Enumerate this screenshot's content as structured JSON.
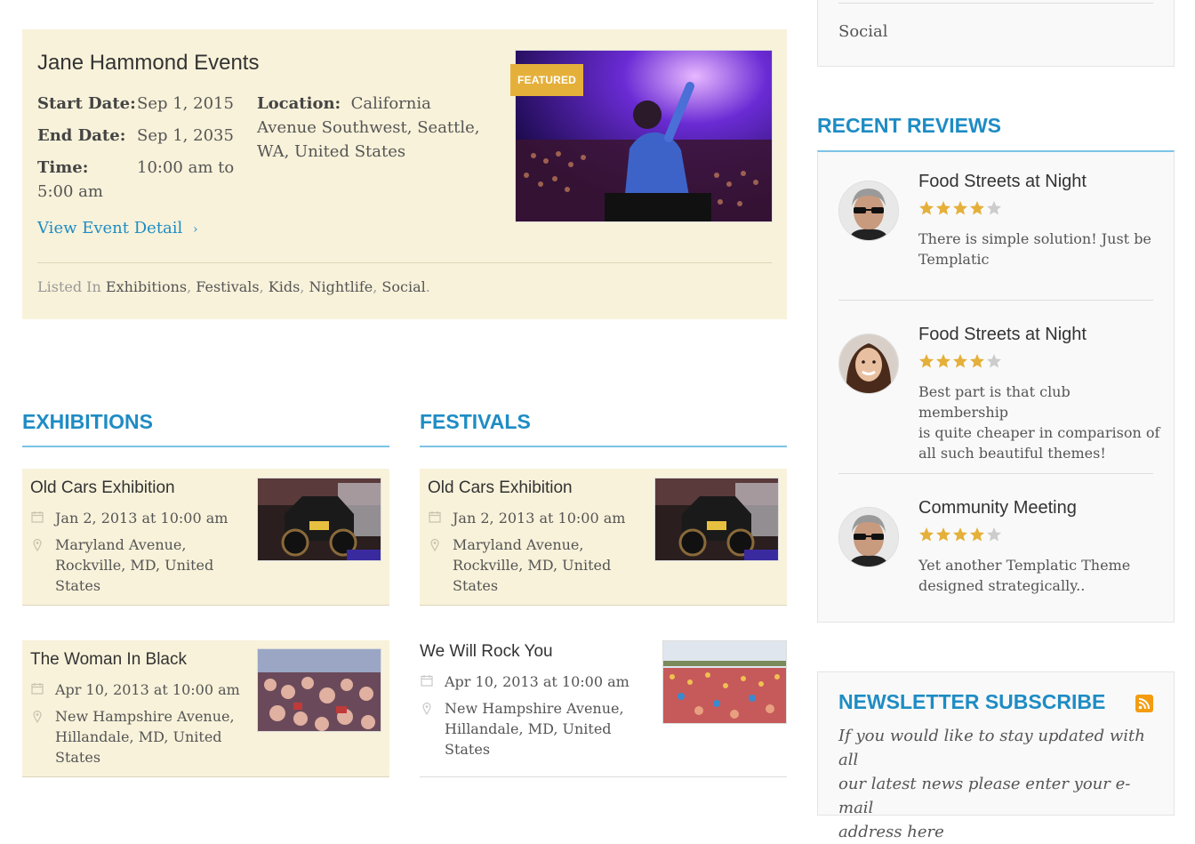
{
  "featured": {
    "title": "Jane Hammond Events",
    "badge": "FEATURED",
    "start_label": "Start Date:",
    "start_value": "Sep 1, 2015",
    "end_label": "End Date:",
    "end_value": "Sep 1, 2035",
    "time_label": "Time:",
    "time_value": "10:00 am to",
    "time_value_2": "5:00 am",
    "location_label": "Location:",
    "location_value_1": "California",
    "location_value_2": "Avenue Southwest, Seattle,",
    "location_value_3": "WA, United States",
    "view_link": "View Event Detail",
    "listed_label": "Listed In",
    "categories": [
      "Exhibitions",
      "Festivals",
      "Kids",
      "Nightlife",
      "Social"
    ]
  },
  "exhibitions": {
    "heading": "EXHIBITIONS",
    "events": [
      {
        "title": "Old Cars Exhibition",
        "date": "Jan 2, 2013 at 10:00 am",
        "addr1": "Maryland Avenue,",
        "addr2": "Rockville, MD, United",
        "addr3": "States"
      },
      {
        "title": "The Woman In Black",
        "date": "Apr 10, 2013 at 10:00 am",
        "addr1": "New Hampshire Avenue,",
        "addr2": "Hillandale, MD, United",
        "addr3": "States"
      }
    ]
  },
  "festivals": {
    "heading": "FESTIVALS",
    "events": [
      {
        "title": "Old Cars Exhibition",
        "date": "Jan 2, 2013 at 10:00 am",
        "addr1": "Maryland Avenue,",
        "addr2": "Rockville, MD, United",
        "addr3": "States"
      },
      {
        "title": "We Will Rock You",
        "date": "Apr 10, 2013 at 10:00 am",
        "addr1": "New Hampshire Avenue,",
        "addr2": "Hillandale, MD, United",
        "addr3": "States"
      }
    ]
  },
  "sidebar": {
    "top_item": "Social",
    "reviews_heading": "RECENT REVIEWS",
    "reviews": [
      {
        "title": "Food Streets at Night",
        "rating": 4,
        "text_1": "There is simple solution! Just be",
        "text_2": "Templatic",
        "text_3": ""
      },
      {
        "title": "Food Streets at Night",
        "rating": 4,
        "text_1": "Best part is that club membership",
        "text_2": "is quite cheaper in comparison of",
        "text_3": "all such beautiful themes!"
      },
      {
        "title": "Community Meeting",
        "rating": 4,
        "text_1": "Yet another Templatic Theme",
        "text_2": "designed strategically..",
        "text_3": ""
      }
    ],
    "newsletter_heading": "NEWSLETTER SUBSCRIBE",
    "newsletter_text_1": "If you would like to stay updated with all",
    "newsletter_text_2": "our latest news please enter your e-mail",
    "newsletter_text_3": "address here"
  },
  "colors": {
    "accent": "#1e8cc4",
    "card_bg": "#f8f2da",
    "star": "#e5b03a",
    "badge": "#e5b03a"
  }
}
